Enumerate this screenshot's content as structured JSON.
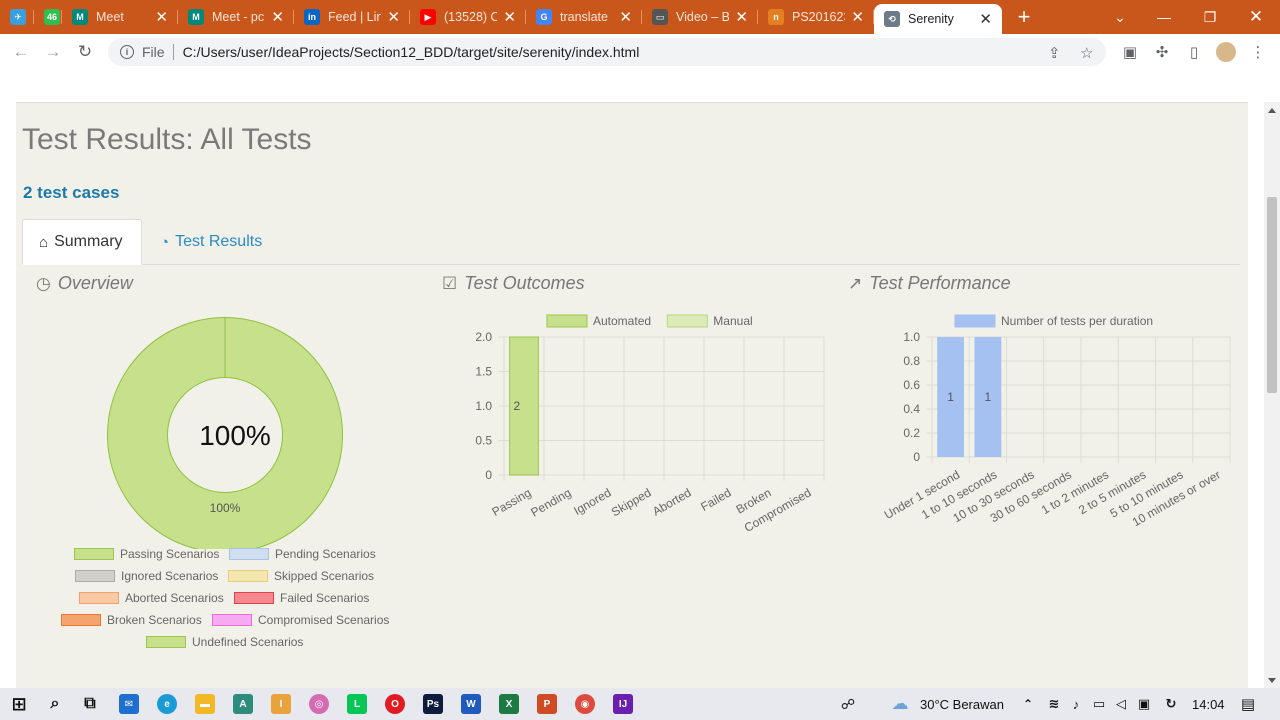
{
  "browser": {
    "tabs": [
      {
        "title": "",
        "color": "#3a9fdc",
        "glyph": "✈"
      },
      {
        "title": "",
        "color": "#2fbf4f",
        "glyph": "46"
      },
      {
        "title": "Meet",
        "color": "#00897b",
        "glyph": "M"
      },
      {
        "title": "Meet - pc",
        "color": "#00897b",
        "glyph": "M"
      },
      {
        "title": "Feed | Lin",
        "color": "#0a66c2",
        "glyph": "in"
      },
      {
        "title": "(13528) O",
        "color": "#ff0000",
        "glyph": "▶"
      },
      {
        "title": "translate",
        "color": "#4285f4",
        "glyph": "G"
      },
      {
        "title": "Video – B",
        "color": "#555555",
        "glyph": "▭"
      },
      {
        "title": "PS201623",
        "color": "#e67e22",
        "glyph": "n"
      },
      {
        "title": "Serenity",
        "color": "#6c7a89",
        "glyph": "⟲"
      }
    ],
    "url_scheme": "File",
    "url": "C:/Users/user/IdeaProjects/Section12_BDD/target/site/serenity/index.html"
  },
  "page": {
    "title": "Test Results: All Tests",
    "subtitle": "2 test cases",
    "tabs": {
      "summary": "Summary",
      "results": "Test Results"
    },
    "overview": {
      "heading": "Overview",
      "center_label": "100%",
      "slice_label": "100%",
      "legend": [
        {
          "label": "Passing Scenarios",
          "fill": "#c6e08b",
          "stroke": "#9cc64e"
        },
        {
          "label": "Pending Scenarios",
          "fill": "#cfdff0",
          "stroke": "#a9c4e3"
        },
        {
          "label": "Ignored Scenarios",
          "fill": "#d1d1cb",
          "stroke": "#aaaaaa"
        },
        {
          "label": "Skipped Scenarios",
          "fill": "#f3e7b0",
          "stroke": "#e5cf75"
        },
        {
          "label": "Aborted Scenarios",
          "fill": "#f9c9a6",
          "stroke": "#f1a26f"
        },
        {
          "label": "Failed Scenarios",
          "fill": "#f4888e",
          "stroke": "#e0424c"
        },
        {
          "label": "Broken Scenarios",
          "fill": "#f6a46e",
          "stroke": "#e87a33"
        },
        {
          "label": "Compromised Scenarios",
          "fill": "#f7aaf0",
          "stroke": "#eb6fdc"
        },
        {
          "label": "Undefined Scenarios",
          "fill": "#c6e08b",
          "stroke": "#9cc64e"
        }
      ]
    },
    "outcomes": {
      "heading": "Test Outcomes"
    },
    "performance": {
      "heading": "Test Performance"
    }
  },
  "chart_data": [
    {
      "type": "pie",
      "categories": [
        "Passing Scenarios"
      ],
      "values": [
        100
      ],
      "colors": [
        "#c6e08b"
      ]
    },
    {
      "type": "bar",
      "categories": [
        "Passing",
        "Pending",
        "Ignored",
        "Skipped",
        "Aborted",
        "Failed",
        "Broken",
        "Compromised"
      ],
      "series": [
        {
          "name": "Automated",
          "values": [
            2,
            0,
            0,
            0,
            0,
            0,
            0,
            0
          ],
          "color": "#c6e08b",
          "stroke": "#9cc64e"
        },
        {
          "name": "Manual",
          "values": [
            0,
            0,
            0,
            0,
            0,
            0,
            0,
            0
          ],
          "color": "#dcebb8",
          "stroke": "#b8d57e"
        }
      ],
      "ylim": [
        0,
        2
      ],
      "yticks": [
        "0",
        "0.5",
        "1.0",
        "1.5",
        "2.0"
      ],
      "data_labels": [
        "2"
      ]
    },
    {
      "type": "bar",
      "categories": [
        "Under 1 second",
        "1 to 10 seconds",
        "10 to 30 seconds",
        "30 to 60 seconds",
        "1 to 2 minutes",
        "2 to 5 minutes",
        "5 to 10 minutes",
        "10 minutes or over"
      ],
      "series": [
        {
          "name": "Number of tests per duration",
          "values": [
            1,
            1,
            0,
            0,
            0,
            0,
            0,
            0
          ],
          "color": "#a4c1f2"
        }
      ],
      "ylim": [
        0,
        1
      ],
      "yticks": [
        "0",
        "0.2",
        "0.4",
        "0.6",
        "0.8",
        "1.0"
      ],
      "data_labels": [
        "1",
        "1"
      ]
    }
  ],
  "taskbar": {
    "weather": "30°C  Berawan",
    "time": "14:04"
  }
}
